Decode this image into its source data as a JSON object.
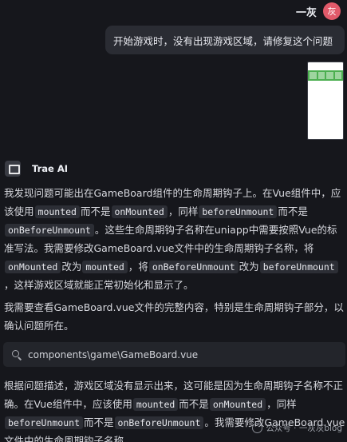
{
  "user": {
    "name": "一灰",
    "avatar_text": "灰",
    "avatar_color": "#e15a6a"
  },
  "user_message": "开始游戏时，没有出现游戏区域，请修复这个问题",
  "ai": {
    "name": "Trae AI"
  },
  "p1": {
    "a": "我发现问题可能出在GameBoard组件的生命周期钩子上。在Vue组件中，应该使用",
    "c1": "mounted",
    "b": "而不是",
    "c2": "onMounted",
    "c": "，同样",
    "c3": "beforeUnmount",
    "d": "而不是",
    "c4": "onBeforeUnmount",
    "e": "。这些生命周期钩子名称在uniapp中需要按照Vue的标准写法。我需要修改GameBoard.vue文件中的生命周期钩子名称，将",
    "c5": "onMounted",
    "f": "改为",
    "c6": "mounted",
    "g": "，将",
    "c7": "onBeforeUnmount",
    "h": "改为",
    "c8": "beforeUnmount",
    "i": "，这样游戏区域就能正常初始化和显示了。"
  },
  "p2": "我需要查看GameBoard.vue文件的完整内容，特别是生命周期钩子部分，以确认问题所在。",
  "file_chip": {
    "path": "components\\game\\GameBoard.vue",
    "icon": "search-icon"
  },
  "p3": {
    "a": "根据问题描述，游戏区域没有显示出来，这可能是因为生命周期钩子名称不正确。在Vue组件中，应该使用",
    "c1": "mounted",
    "b": "而不是",
    "c2": "onMounted",
    "c": "，同样",
    "c3": "beforeUnmount",
    "d": "而不是",
    "c4": "onBeforeUnmount",
    "e": "。我需要修改GameBoard.vue文件中的生命周期钩子名称。"
  },
  "watermark": "公众号 · 一灰灰blog"
}
